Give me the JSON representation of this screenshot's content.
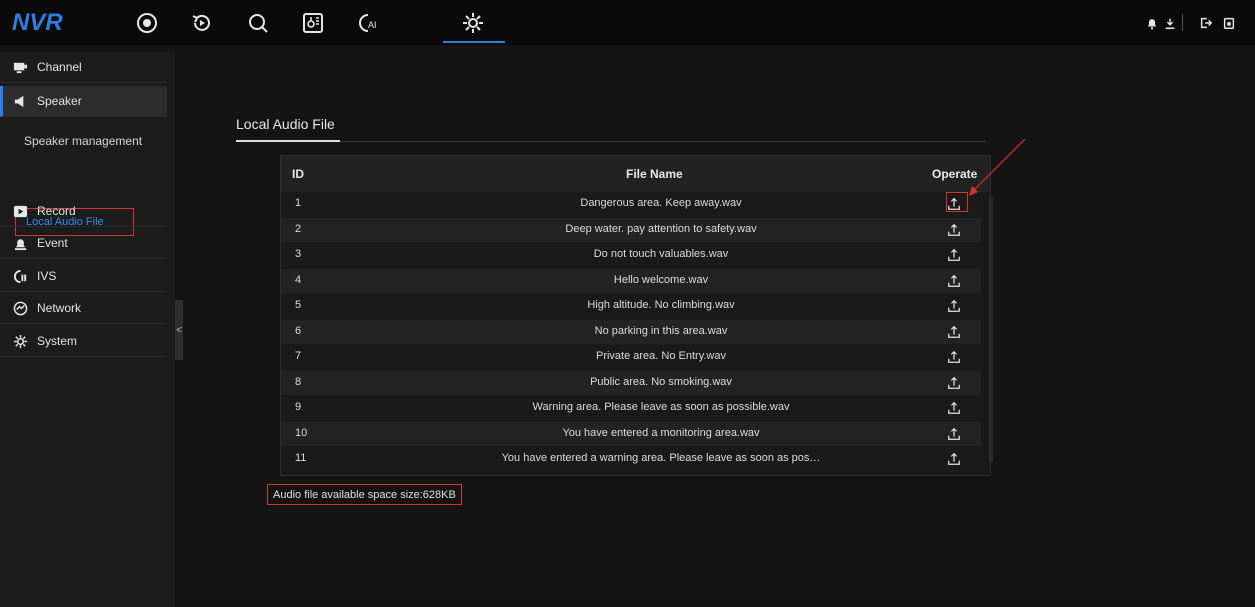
{
  "app": {
    "logo": "NVR"
  },
  "topnav": [
    {
      "name": "live-view-icon"
    },
    {
      "name": "playback-icon"
    },
    {
      "name": "search-icon"
    },
    {
      "name": "temperature-icon"
    },
    {
      "name": "ai-icon"
    },
    {
      "name": "settings-gear-icon",
      "active": true
    }
  ],
  "topright": [
    "bell-icon",
    "user-icon",
    "logout-icon",
    "lock-icon"
  ],
  "sidebar": {
    "items": [
      {
        "label": "Channel",
        "icon": "monitor-icon"
      },
      {
        "label": "Speaker",
        "icon": "speaker-icon"
      },
      {
        "label": "Record",
        "icon": "record-icon"
      },
      {
        "label": "Event",
        "icon": "event-icon"
      },
      {
        "label": "IVS",
        "icon": "ivs-icon"
      },
      {
        "label": "Network",
        "icon": "network-icon"
      },
      {
        "label": "System",
        "icon": "system-icon"
      }
    ],
    "sub_items": [
      {
        "label": "Speaker management"
      },
      {
        "label": "Local Audio File"
      }
    ],
    "collapse": "<"
  },
  "main": {
    "tab_title": "Local Audio File",
    "table": {
      "headers": {
        "id": "ID",
        "file_name": "File Name",
        "operate": "Operate"
      },
      "rows": [
        {
          "id": "1",
          "file_name": "Dangerous area. Keep away.wav"
        },
        {
          "id": "2",
          "file_name": "Deep water. pay attention to safety.wav"
        },
        {
          "id": "3",
          "file_name": "Do not touch valuables.wav"
        },
        {
          "id": "4",
          "file_name": "Hello welcome.wav"
        },
        {
          "id": "5",
          "file_name": "High altitude. No climbing.wav"
        },
        {
          "id": "6",
          "file_name": "No parking in this area.wav"
        },
        {
          "id": "7",
          "file_name": "Private area. No Entry.wav"
        },
        {
          "id": "8",
          "file_name": "Public area. No smoking.wav"
        },
        {
          "id": "9",
          "file_name": "Warning area. Please leave as soon as possible.wav"
        },
        {
          "id": "10",
          "file_name": "You have entered a monitoring area.wav"
        },
        {
          "id": "11",
          "file_name": "You have entered a warning area. Please leave as soon as pos…"
        }
      ]
    },
    "space_note": "Audio file available space size:628KB"
  },
  "colors": {
    "accent": "#2f7de1",
    "highlight": "#d0352e",
    "background": "#141414"
  }
}
